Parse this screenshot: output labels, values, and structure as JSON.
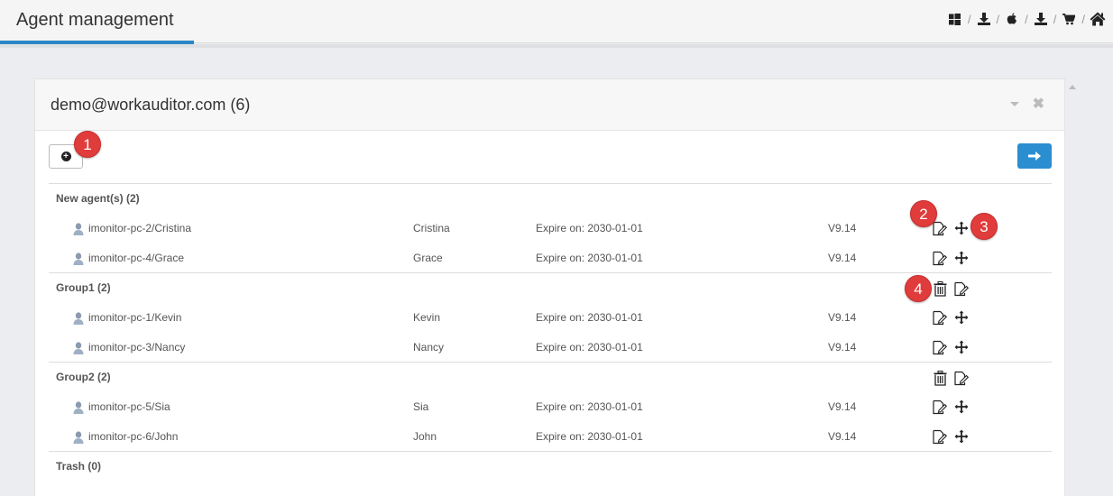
{
  "header": {
    "title": "Agent management",
    "icons": [
      "windows-icon",
      "download-icon",
      "apple-icon",
      "download-icon",
      "cart-icon",
      "home-icon"
    ],
    "separator": "/"
  },
  "panel": {
    "title": "demo@workauditor.com (6)"
  },
  "groups": [
    {
      "name": "New agent(s) (2)",
      "agents": [
        {
          "name": "imonitor-pc-2/Cristina",
          "user": "Cristina",
          "expire": "Expire on: 2030-01-01",
          "version": "V9.14"
        },
        {
          "name": "imonitor-pc-4/Grace",
          "user": "Grace",
          "expire": "Expire on: 2030-01-01",
          "version": "V9.14"
        }
      ]
    },
    {
      "name": "Group1 (2)",
      "agents": [
        {
          "name": "imonitor-pc-1/Kevin",
          "user": "Kevin",
          "expire": "Expire on: 2030-01-01",
          "version": "V9.14"
        },
        {
          "name": "imonitor-pc-3/Nancy",
          "user": "Nancy",
          "expire": "Expire on: 2030-01-01",
          "version": "V9.14"
        }
      ]
    },
    {
      "name": "Group2 (2)",
      "agents": [
        {
          "name": "imonitor-pc-5/Sia",
          "user": "Sia",
          "expire": "Expire on: 2030-01-01",
          "version": "V9.14"
        },
        {
          "name": "imonitor-pc-6/John",
          "user": "John",
          "expire": "Expire on: 2030-01-01",
          "version": "V9.14"
        }
      ]
    },
    {
      "name": "Trash (0)",
      "agents": []
    }
  ],
  "badges": [
    "1",
    "2",
    "3",
    "4"
  ],
  "colors": {
    "accent": "#2a8ed0",
    "badge": "#e03c3c"
  }
}
